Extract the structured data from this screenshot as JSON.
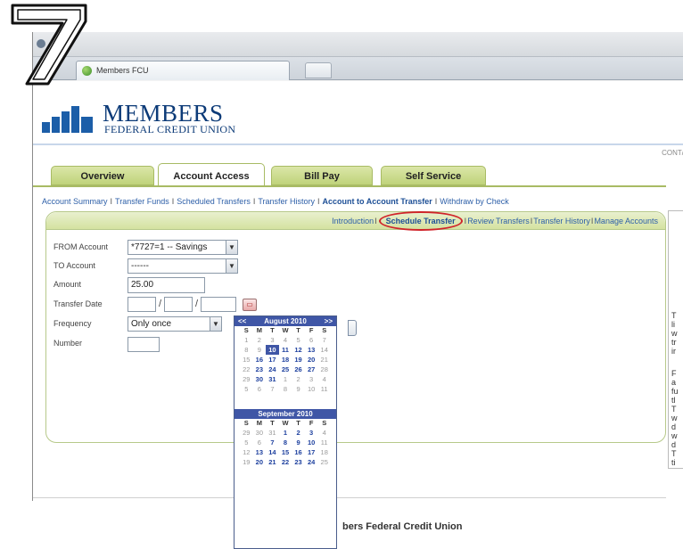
{
  "step": {
    "number": "7"
  },
  "browser": {
    "tab_title": "Members FCU"
  },
  "header": {
    "logo_line1": "MEMBERS",
    "logo_line2": "FEDERAL CREDIT UNION",
    "contact_link": "CONT/"
  },
  "nav": {
    "tabs": [
      {
        "label": "Overview",
        "active": false
      },
      {
        "label": "Account Access",
        "active": true
      },
      {
        "label": "Bill Pay",
        "active": false
      },
      {
        "label": "Self Service",
        "active": false
      }
    ]
  },
  "subnav": {
    "items": [
      "Account Summary",
      "Transfer Funds",
      "Scheduled Transfers",
      "Transfer History",
      "Account to Account Transfer",
      "Withdraw by Check"
    ]
  },
  "panel_links": {
    "items": [
      "Introduction",
      "Schedule Transfer",
      "Review Transfers",
      "Transfer History",
      "Manage Accounts"
    ]
  },
  "form": {
    "from_label": "FROM Account",
    "from_value": "*7727=1 -- Savings",
    "to_label": "TO Account",
    "to_value": "------",
    "amount_label": "Amount",
    "amount_value": "25.00",
    "date_label": "Transfer Date",
    "date_sep": "/",
    "frequency_label": "Frequency",
    "frequency_value": "Only once",
    "number_label": "Number"
  },
  "calendar": {
    "prev": "<<",
    "next": ">>",
    "day_headers": [
      "S",
      "M",
      "T",
      "W",
      "T",
      "F",
      "S"
    ],
    "month1": "August 2010",
    "month2": "September 2010"
  },
  "sidebar": {
    "letters": [
      "T",
      "li",
      "w",
      "tr",
      "ir",
      "",
      "F",
      "a",
      "fu",
      "tl",
      "T",
      "w",
      "d",
      "w",
      "d",
      "T",
      "ti",
      "d",
      "ir"
    ]
  },
  "footer": {
    "text": "bers Federal Credit Union"
  }
}
